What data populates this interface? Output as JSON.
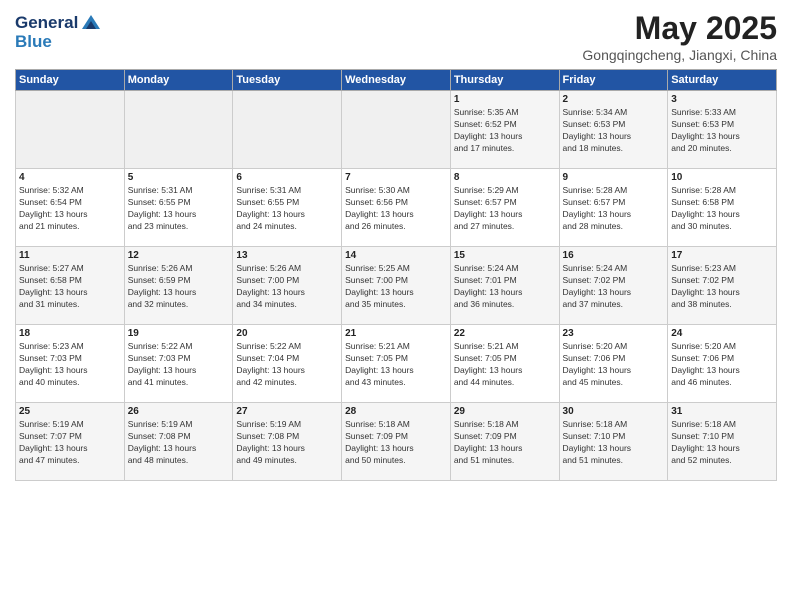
{
  "header": {
    "logo_line1": "General",
    "logo_line2": "Blue",
    "title": "May 2025",
    "location": "Gongqingcheng, Jiangxi, China"
  },
  "weekdays": [
    "Sunday",
    "Monday",
    "Tuesday",
    "Wednesday",
    "Thursday",
    "Friday",
    "Saturday"
  ],
  "weeks": [
    [
      {
        "day": "",
        "info": ""
      },
      {
        "day": "",
        "info": ""
      },
      {
        "day": "",
        "info": ""
      },
      {
        "day": "",
        "info": ""
      },
      {
        "day": "1",
        "info": "Sunrise: 5:35 AM\nSunset: 6:52 PM\nDaylight: 13 hours\nand 17 minutes."
      },
      {
        "day": "2",
        "info": "Sunrise: 5:34 AM\nSunset: 6:53 PM\nDaylight: 13 hours\nand 18 minutes."
      },
      {
        "day": "3",
        "info": "Sunrise: 5:33 AM\nSunset: 6:53 PM\nDaylight: 13 hours\nand 20 minutes."
      }
    ],
    [
      {
        "day": "4",
        "info": "Sunrise: 5:32 AM\nSunset: 6:54 PM\nDaylight: 13 hours\nand 21 minutes."
      },
      {
        "day": "5",
        "info": "Sunrise: 5:31 AM\nSunset: 6:55 PM\nDaylight: 13 hours\nand 23 minutes."
      },
      {
        "day": "6",
        "info": "Sunrise: 5:31 AM\nSunset: 6:55 PM\nDaylight: 13 hours\nand 24 minutes."
      },
      {
        "day": "7",
        "info": "Sunrise: 5:30 AM\nSunset: 6:56 PM\nDaylight: 13 hours\nand 26 minutes."
      },
      {
        "day": "8",
        "info": "Sunrise: 5:29 AM\nSunset: 6:57 PM\nDaylight: 13 hours\nand 27 minutes."
      },
      {
        "day": "9",
        "info": "Sunrise: 5:28 AM\nSunset: 6:57 PM\nDaylight: 13 hours\nand 28 minutes."
      },
      {
        "day": "10",
        "info": "Sunrise: 5:28 AM\nSunset: 6:58 PM\nDaylight: 13 hours\nand 30 minutes."
      }
    ],
    [
      {
        "day": "11",
        "info": "Sunrise: 5:27 AM\nSunset: 6:58 PM\nDaylight: 13 hours\nand 31 minutes."
      },
      {
        "day": "12",
        "info": "Sunrise: 5:26 AM\nSunset: 6:59 PM\nDaylight: 13 hours\nand 32 minutes."
      },
      {
        "day": "13",
        "info": "Sunrise: 5:26 AM\nSunset: 7:00 PM\nDaylight: 13 hours\nand 34 minutes."
      },
      {
        "day": "14",
        "info": "Sunrise: 5:25 AM\nSunset: 7:00 PM\nDaylight: 13 hours\nand 35 minutes."
      },
      {
        "day": "15",
        "info": "Sunrise: 5:24 AM\nSunset: 7:01 PM\nDaylight: 13 hours\nand 36 minutes."
      },
      {
        "day": "16",
        "info": "Sunrise: 5:24 AM\nSunset: 7:02 PM\nDaylight: 13 hours\nand 37 minutes."
      },
      {
        "day": "17",
        "info": "Sunrise: 5:23 AM\nSunset: 7:02 PM\nDaylight: 13 hours\nand 38 minutes."
      }
    ],
    [
      {
        "day": "18",
        "info": "Sunrise: 5:23 AM\nSunset: 7:03 PM\nDaylight: 13 hours\nand 40 minutes."
      },
      {
        "day": "19",
        "info": "Sunrise: 5:22 AM\nSunset: 7:03 PM\nDaylight: 13 hours\nand 41 minutes."
      },
      {
        "day": "20",
        "info": "Sunrise: 5:22 AM\nSunset: 7:04 PM\nDaylight: 13 hours\nand 42 minutes."
      },
      {
        "day": "21",
        "info": "Sunrise: 5:21 AM\nSunset: 7:05 PM\nDaylight: 13 hours\nand 43 minutes."
      },
      {
        "day": "22",
        "info": "Sunrise: 5:21 AM\nSunset: 7:05 PM\nDaylight: 13 hours\nand 44 minutes."
      },
      {
        "day": "23",
        "info": "Sunrise: 5:20 AM\nSunset: 7:06 PM\nDaylight: 13 hours\nand 45 minutes."
      },
      {
        "day": "24",
        "info": "Sunrise: 5:20 AM\nSunset: 7:06 PM\nDaylight: 13 hours\nand 46 minutes."
      }
    ],
    [
      {
        "day": "25",
        "info": "Sunrise: 5:19 AM\nSunset: 7:07 PM\nDaylight: 13 hours\nand 47 minutes."
      },
      {
        "day": "26",
        "info": "Sunrise: 5:19 AM\nSunset: 7:08 PM\nDaylight: 13 hours\nand 48 minutes."
      },
      {
        "day": "27",
        "info": "Sunrise: 5:19 AM\nSunset: 7:08 PM\nDaylight: 13 hours\nand 49 minutes."
      },
      {
        "day": "28",
        "info": "Sunrise: 5:18 AM\nSunset: 7:09 PM\nDaylight: 13 hours\nand 50 minutes."
      },
      {
        "day": "29",
        "info": "Sunrise: 5:18 AM\nSunset: 7:09 PM\nDaylight: 13 hours\nand 51 minutes."
      },
      {
        "day": "30",
        "info": "Sunrise: 5:18 AM\nSunset: 7:10 PM\nDaylight: 13 hours\nand 51 minutes."
      },
      {
        "day": "31",
        "info": "Sunrise: 5:18 AM\nSunset: 7:10 PM\nDaylight: 13 hours\nand 52 minutes."
      }
    ]
  ]
}
